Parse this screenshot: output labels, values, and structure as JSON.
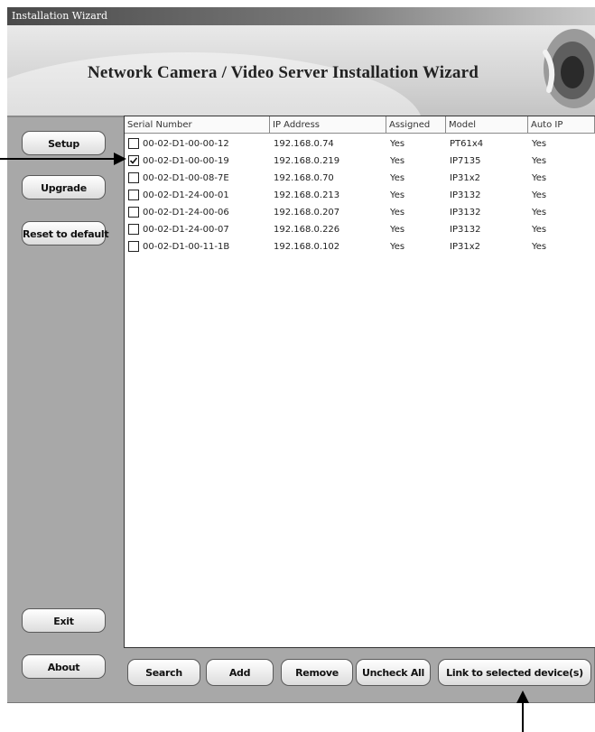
{
  "window": {
    "title": "Installation Wizard"
  },
  "banner": {
    "title": "Network Camera / Video Server Installation Wizard"
  },
  "sidebar": {
    "setup": "Setup",
    "upgrade": "Upgrade",
    "reset": "Reset to default",
    "exit": "Exit",
    "about": "About"
  },
  "table": {
    "headers": [
      "Serial Number",
      "IP Address",
      "Assigned",
      "Model",
      "Auto IP"
    ],
    "rows": [
      {
        "checked": false,
        "serial": "00-02-D1-00-00-12",
        "ip": "192.168.0.74",
        "assigned": "Yes",
        "model": "PT61x4",
        "auto_ip": "Yes"
      },
      {
        "checked": true,
        "serial": "00-02-D1-00-00-19",
        "ip": "192.168.0.219",
        "assigned": "Yes",
        "model": "IP7135",
        "auto_ip": "Yes"
      },
      {
        "checked": false,
        "serial": "00-02-D1-00-08-7E",
        "ip": "192.168.0.70",
        "assigned": "Yes",
        "model": "IP31x2",
        "auto_ip": "Yes"
      },
      {
        "checked": false,
        "serial": "00-02-D1-24-00-01",
        "ip": "192.168.0.213",
        "assigned": "Yes",
        "model": "IP3132",
        "auto_ip": "Yes"
      },
      {
        "checked": false,
        "serial": "00-02-D1-24-00-06",
        "ip": "192.168.0.207",
        "assigned": "Yes",
        "model": "IP3132",
        "auto_ip": "Yes"
      },
      {
        "checked": false,
        "serial": "00-02-D1-24-00-07",
        "ip": "192.168.0.226",
        "assigned": "Yes",
        "model": "IP3132",
        "auto_ip": "Yes"
      },
      {
        "checked": false,
        "serial": "00-02-D1-00-11-1B",
        "ip": "192.168.0.102",
        "assigned": "Yes",
        "model": "IP31x2",
        "auto_ip": "Yes"
      }
    ]
  },
  "actions": {
    "search": "Search",
    "add": "Add",
    "remove": "Remove",
    "uncheck_all": "Uncheck All",
    "link": "Link to selected device(s)"
  }
}
